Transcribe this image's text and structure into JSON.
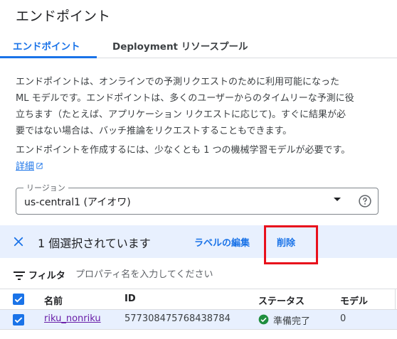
{
  "page": {
    "title": "エンドポイント"
  },
  "tabs": [
    {
      "label": "エンドポイント",
      "active": true
    },
    {
      "label": "Deployment リソースプール",
      "active": false
    }
  ],
  "description": {
    "line1": "エンドポイントは、オンラインでの予測リクエストのために利用可能になった",
    "line2": "ML モデルです。エンドポイントは、多くのユーザーからのタイムリーな予測に役",
    "line3": "立ちます（たとえば、アプリケーション リクエストに応じて)。すぐに結果が必",
    "line4": "要ではない場合は、バッチ推論をリクエストすることもできます。",
    "note": "エンドポイントを作成するには、少なくとも 1 つの機械学習モデルが必要です。",
    "details_link": "詳細"
  },
  "region": {
    "label": "リージョン",
    "value": "us-central1 (アイオワ)"
  },
  "selection": {
    "text": "1 個選択されています",
    "edit_labels": "ラベルの編集",
    "delete": "削除"
  },
  "filter": {
    "label": "フィルタ",
    "placeholder": "プロパティ名を入力してください"
  },
  "table": {
    "headers": {
      "name": "名前",
      "id": "ID",
      "status": "ステータス",
      "model": "モデル"
    },
    "rows": [
      {
        "name": "riku_nonriku",
        "id": "577308475768438784",
        "status": "準備完了",
        "model": "0",
        "selected": true
      }
    ]
  },
  "colors": {
    "accent": "#1a73e8",
    "selection_bg": "#e8f0fe",
    "highlight_box": "#e8101c",
    "status_ok": "#1e8e3e"
  },
  "icons": [
    "close-icon",
    "dropdown-arrow-icon",
    "help-icon",
    "filter-icon",
    "external-link-icon",
    "checkbox-checked-icon",
    "check-circle-icon"
  ]
}
